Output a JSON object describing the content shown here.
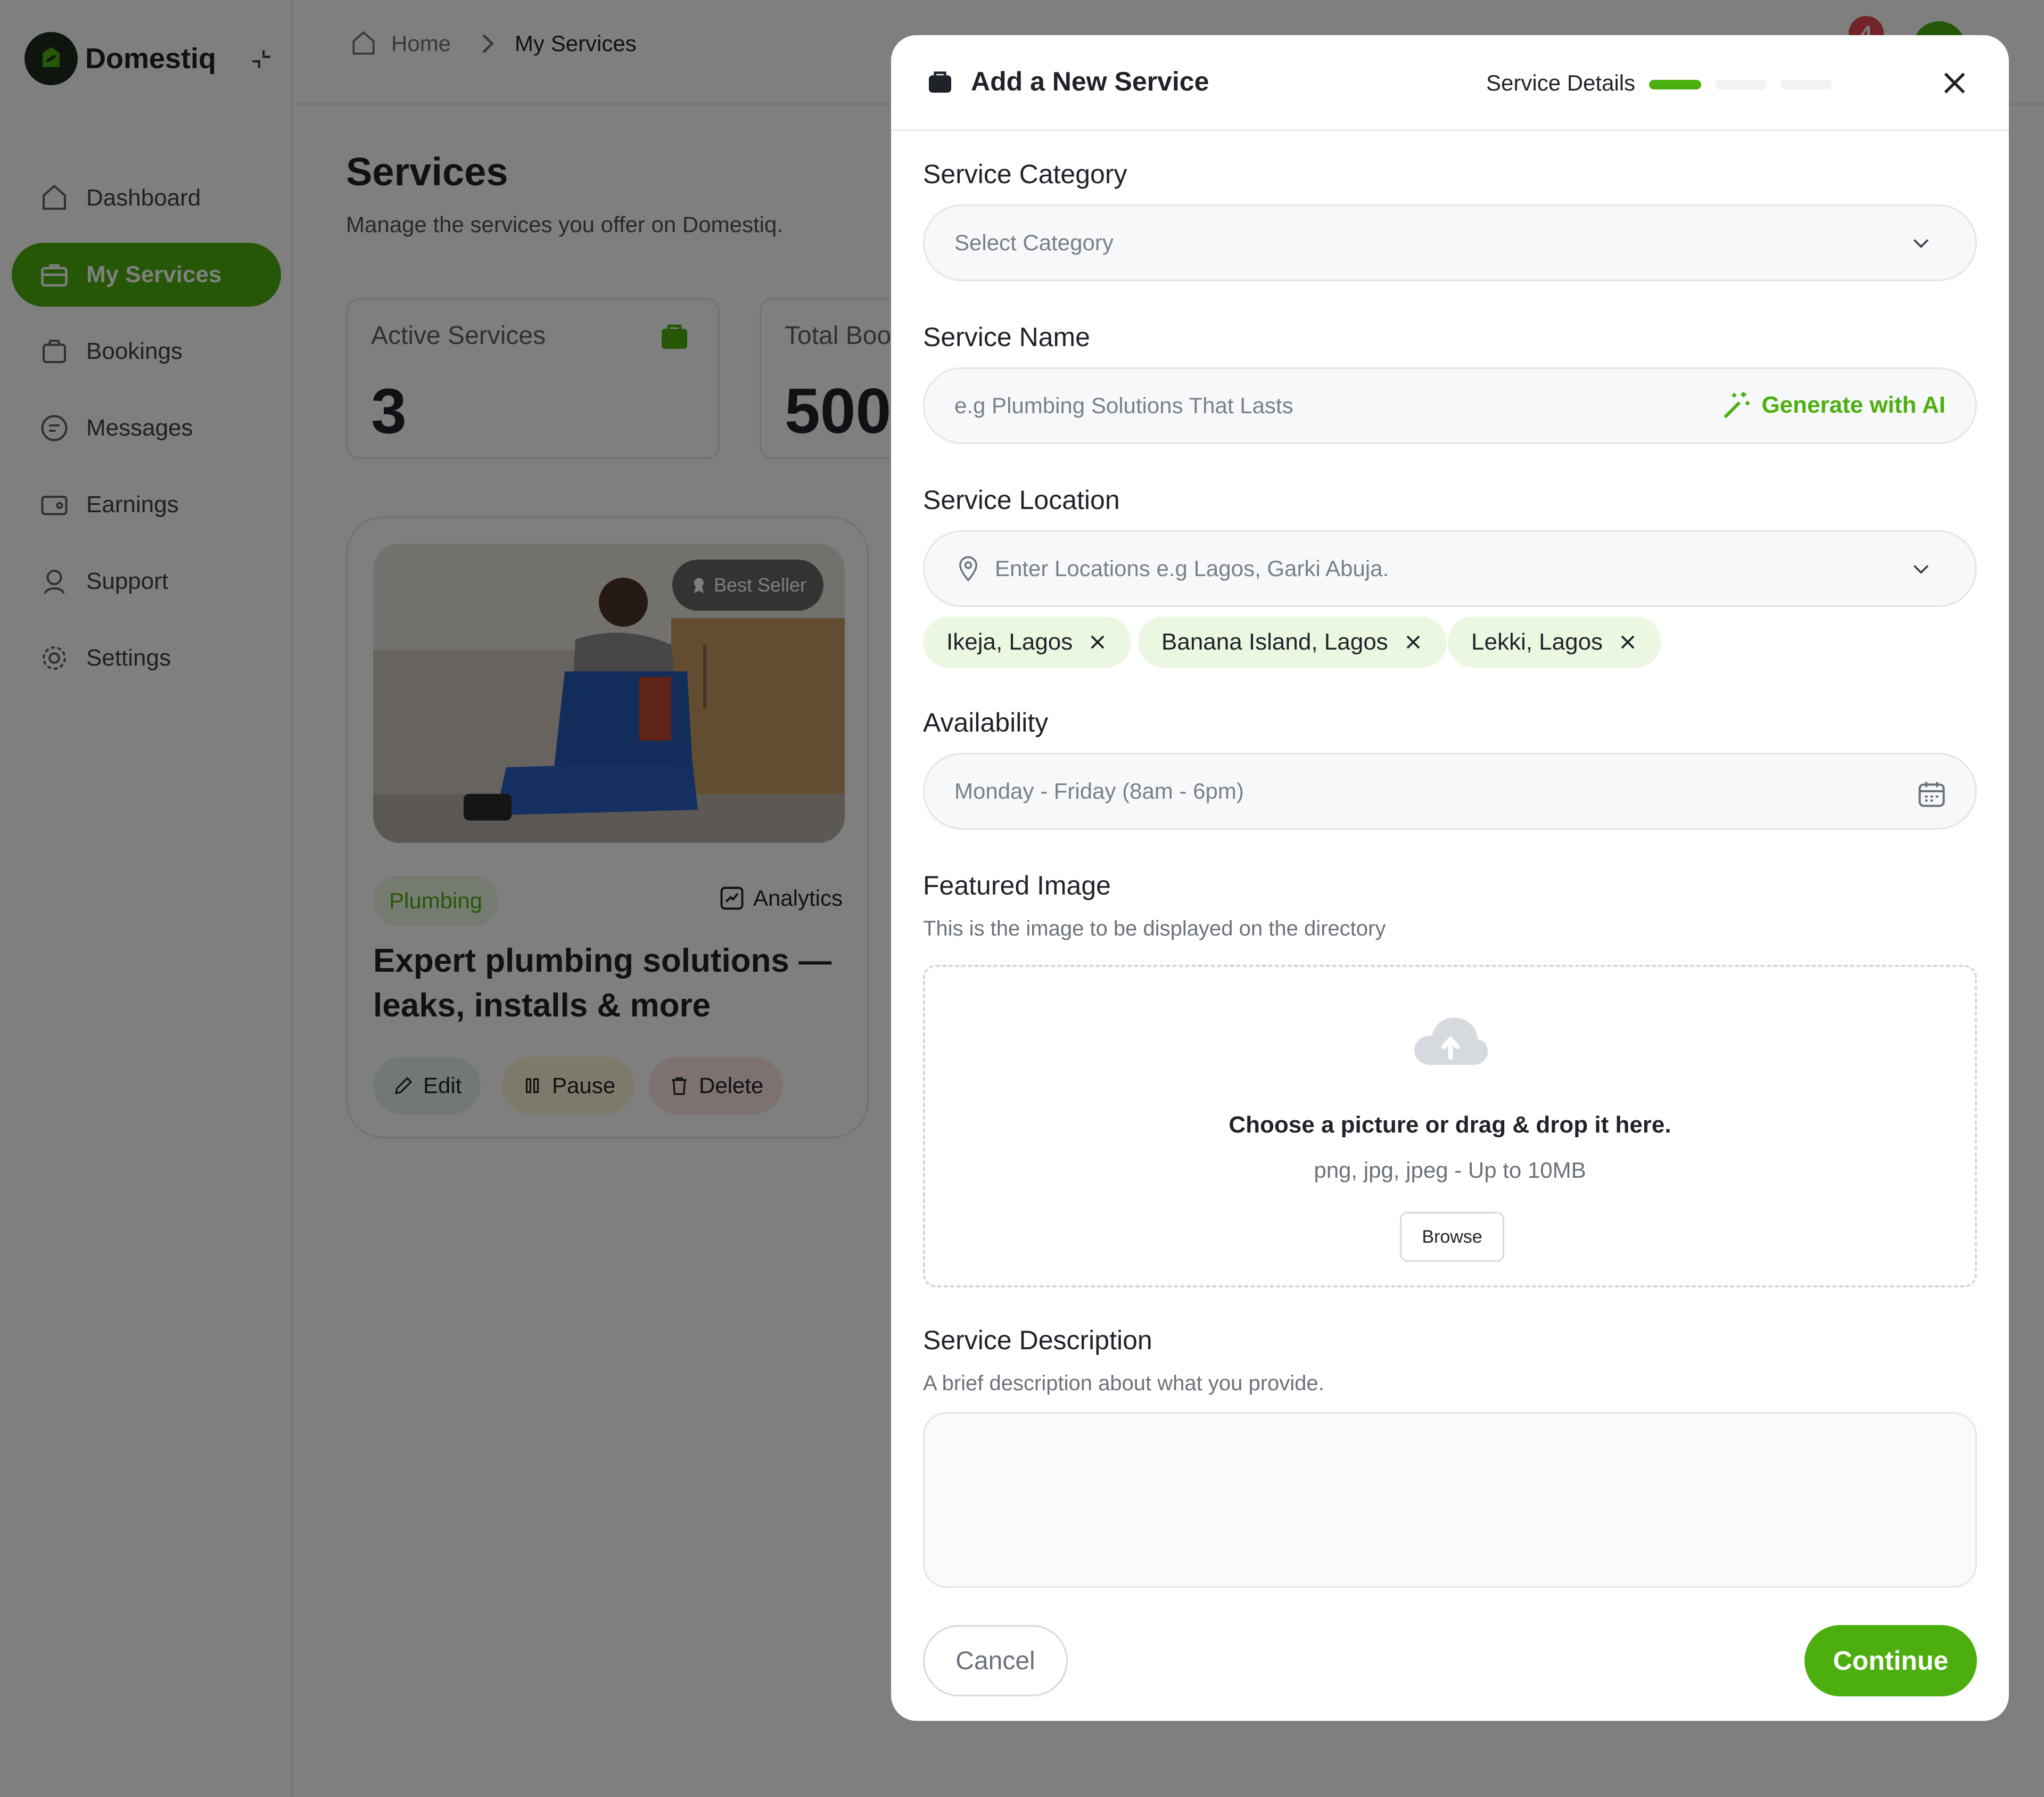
{
  "brand": {
    "name": "Domestiq"
  },
  "sidebar": {
    "items": [
      {
        "label": "Dashboard",
        "icon": "home-icon",
        "active": false
      },
      {
        "label": "My Services",
        "icon": "briefcase-icon",
        "active": true
      },
      {
        "label": "Bookings",
        "icon": "bag-icon",
        "active": false
      },
      {
        "label": "Messages",
        "icon": "chat-icon",
        "active": false
      },
      {
        "label": "Earnings",
        "icon": "wallet-icon",
        "active": false
      },
      {
        "label": "Support",
        "icon": "support-icon",
        "active": false
      },
      {
        "label": "Settings",
        "icon": "gear-icon",
        "active": false
      }
    ]
  },
  "breadcrumb": {
    "home": "Home",
    "current": "My Services"
  },
  "notifications": {
    "count": "4"
  },
  "page": {
    "title": "Services",
    "subtitle": "Manage the services you offer on Domestiq."
  },
  "stats": [
    {
      "label": "Active Services",
      "value": "3"
    },
    {
      "label": "Total Boo",
      "value": "500"
    }
  ],
  "service_card": {
    "badge": "Best Seller",
    "category": "Plumbing",
    "analytics_label": "Analytics",
    "title": "Expert plumbing solutions — leaks, installs & more",
    "actions": {
      "edit": "Edit",
      "pause": "Pause",
      "delete": "Delete"
    }
  },
  "modal": {
    "title": "Add a New Service",
    "step_label": "Service Details",
    "steps_total": 3,
    "steps_active": 1,
    "category": {
      "label": "Service Category",
      "placeholder": "Select Category"
    },
    "name": {
      "label": "Service Name",
      "placeholder": "e.g Plumbing Solutions That Lasts",
      "ai_button": "Generate with AI"
    },
    "location": {
      "label": "Service Location",
      "placeholder": "Enter Locations e.g Lagos, Garki Abuja.",
      "chips": [
        "Ikeja, Lagos",
        "Banana Island, Lagos",
        "Lekki, Lagos"
      ]
    },
    "availability": {
      "label": "Availability",
      "value": "Monday - Friday (8am - 6pm)"
    },
    "featured_image": {
      "label": "Featured Image",
      "help": "This is the image to be displayed on the directory",
      "drop_title": "Choose a picture or drag & drop it here.",
      "drop_sub": "png, jpg, jpeg - Up to 10MB",
      "browse": "Browse"
    },
    "description": {
      "label": "Service Description",
      "help": "A brief description about what you provide."
    },
    "cancel": "Cancel",
    "continue": "Continue"
  },
  "colors": {
    "accent": "#4caf0f",
    "overlay": "rgba(0,0,0,0.5)",
    "chip_bg": "#ecf7e2"
  }
}
